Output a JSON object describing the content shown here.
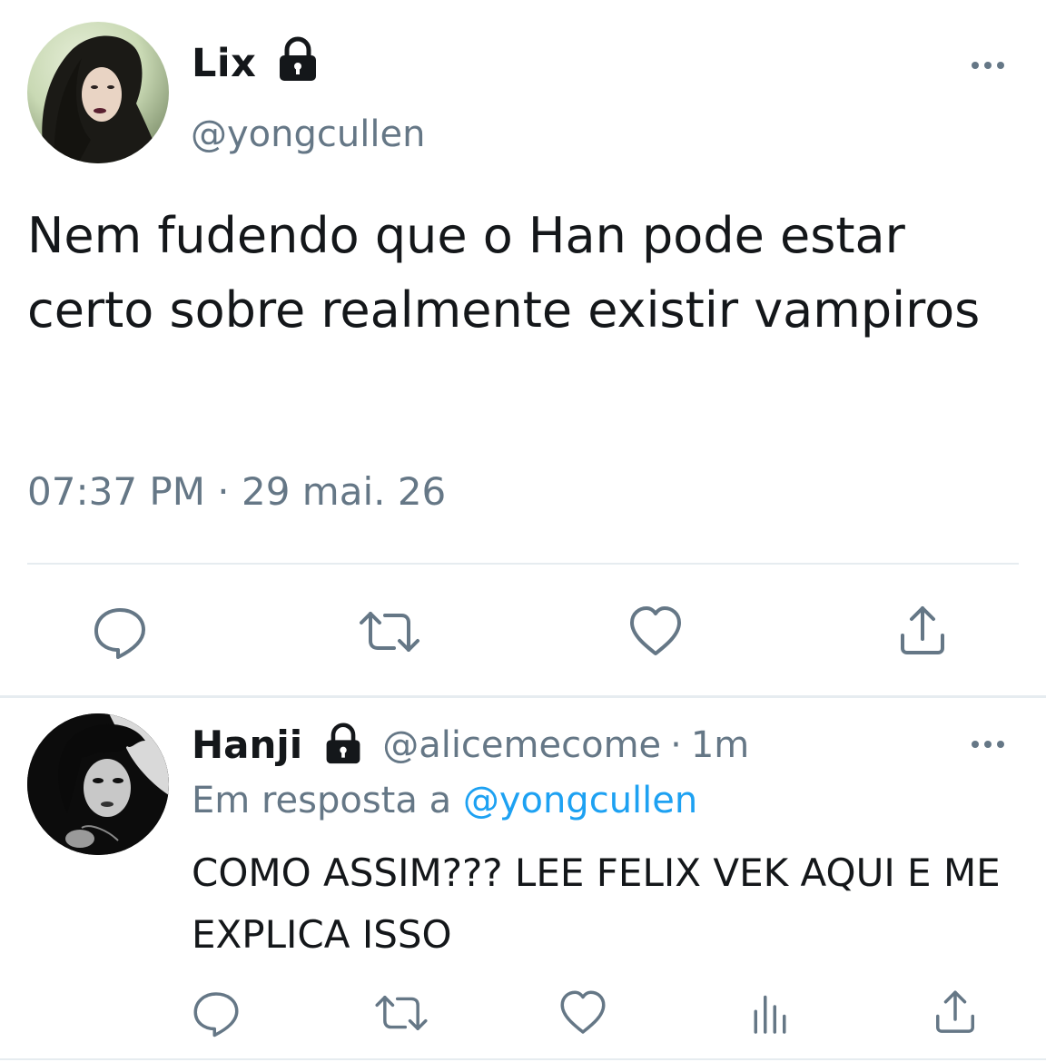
{
  "main_tweet": {
    "author_name": "Lix",
    "author_handle": "@yongcullen",
    "protected_icon": "lock-icon",
    "menu_icon": "more-horizontal-icon",
    "text": "Nem fudendo que o Han pode estar certo sobre realmente existir vampiros",
    "timestamp": "07:37 PM · 29 mai. 26",
    "actions": [
      "reply-icon",
      "retweet-icon",
      "like-icon",
      "share-icon"
    ]
  },
  "reply_tweet": {
    "author_name": "Hanji",
    "author_handle": "@alicemecome",
    "separator": "·",
    "time_ago": "1m",
    "protected_icon": "lock-icon",
    "menu_icon": "more-horizontal-icon",
    "reply_prefix": "Em resposta a",
    "reply_to_handle": "@yongcullen",
    "text": "COMO ASSIM??? LEE FELIX VEK AQUI E ME EXPLICA ISSO",
    "actions": [
      "reply-icon",
      "retweet-icon",
      "like-icon",
      "analytics-icon",
      "share-icon"
    ]
  },
  "colors": {
    "text_primary": "#14171a",
    "text_secondary": "#657786",
    "link": "#1da1f2",
    "divider": "#e6ecf0"
  }
}
